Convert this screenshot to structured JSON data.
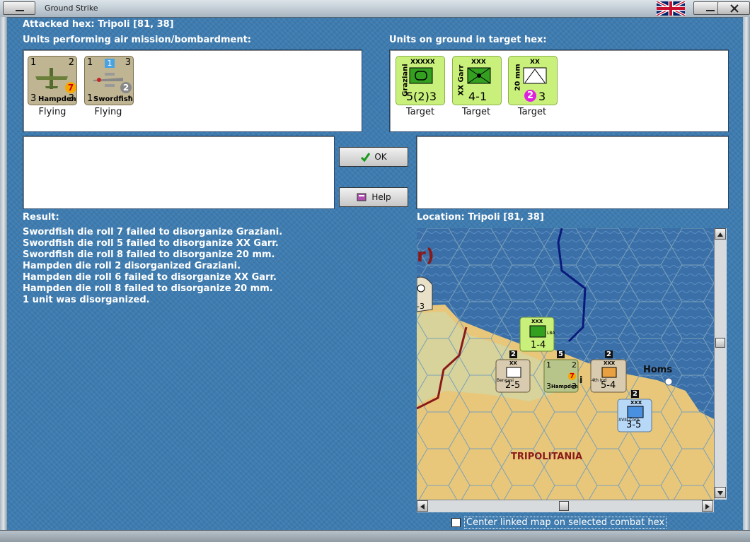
{
  "window": {
    "title": "Ground Strike"
  },
  "header": {
    "attacked_hex": "Attacked hex: Tripoli  [81, 38]"
  },
  "air_panel": {
    "label": "Units performing air mission/bombardment:",
    "units": [
      {
        "name": "Hampden",
        "tl": "1",
        "tr": "2",
        "bl": "3",
        "br": "3",
        "roll": "7",
        "status": "Flying"
      },
      {
        "name": "Swordfish",
        "tl": "1",
        "tr": "3",
        "bl": "1",
        "badge": "1",
        "roll": "2",
        "mark": "*",
        "status": "Flying"
      }
    ]
  },
  "ground_panel": {
    "label": "Units on ground in target hex:",
    "units": [
      {
        "name": "Graziani",
        "size": "XXXXX",
        "strength": "5(2)3",
        "status": "Target"
      },
      {
        "name": "XX Garr",
        "size": "XXX",
        "strength": "4-1",
        "status": "Target"
      },
      {
        "name": "20 mm",
        "size": "XX",
        "roll": "2",
        "strength": "3",
        "status": "Target"
      }
    ]
  },
  "buttons": {
    "ok": "OK",
    "help": "Help"
  },
  "result": {
    "label": "Result:",
    "lines": [
      "Swordfish die roll 7 failed to disorganize Graziani.",
      "Swordfish die roll 5 failed to disorganize XX Garr.",
      "Swordfish die roll 8 failed to disorganize 20 mm.",
      "Hampden die roll 2 disorganized Graziani.",
      "Hampden die roll 6 failed to disorganize XX Garr.",
      "Hampden die roll 8 failed to disorganize 20 mm.",
      "1 unit was disorganized."
    ]
  },
  "location": {
    "label": "Location:  Tripoli  [81, 38]",
    "map": {
      "region": "TRIPOLITANIA",
      "city": "Homs",
      "partial_text": "r)",
      "partial_city": "i",
      "partial_counter": "-3",
      "counters": [
        {
          "size": "XXX",
          "strength": "1-4",
          "label": "LBA",
          "top_label": ""
        },
        {
          "size": "XX",
          "strength": "2-5",
          "label": "Bengasi",
          "top_label": "2"
        },
        {
          "size": "",
          "strength": "",
          "label": "Hampden",
          "top_label": "5",
          "tl": "1",
          "tr": "2",
          "bl": "3",
          "br": "3",
          "roll": "7"
        },
        {
          "size": "XXX",
          "strength": "5-4",
          "label": "4th Ind",
          "top_label": "2"
        },
        {
          "size": "XXX",
          "strength": "3-5",
          "label": "XVIII Corp",
          "top_label": "2"
        }
      ]
    }
  },
  "options": {
    "center_map_label": "Center linked map on selected combat hex"
  },
  "colors": {
    "background": "#3d7bb0",
    "ground_unit": "#c8f07a",
    "air_unit": "#bfb593",
    "sea": "#3a6fa8",
    "desert": "#e8c77a"
  }
}
